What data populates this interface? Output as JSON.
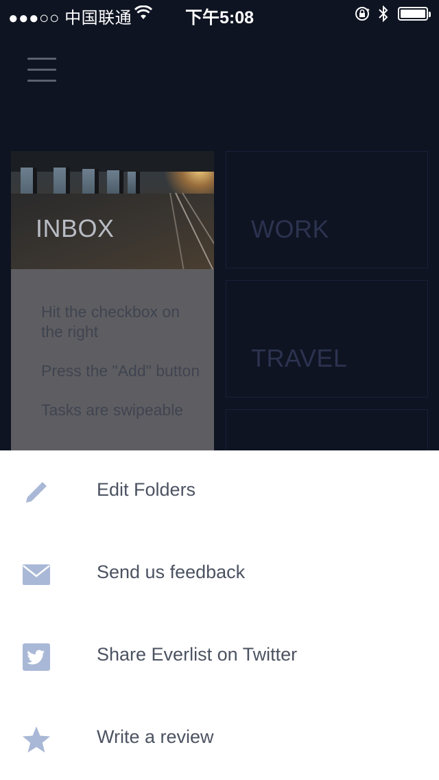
{
  "status_bar": {
    "carrier": "●●●○○ 中国联通",
    "time": "下午5:08",
    "battery_level": 1.0
  },
  "folders": {
    "inbox": {
      "label": "INBOX",
      "tasks": [
        "Hit the checkbox on the right",
        "Press the \"Add\" button",
        "Tasks are swipeable"
      ]
    },
    "work": {
      "label": "WORK"
    },
    "travel": {
      "label": "TRAVEL"
    }
  },
  "menu": {
    "items": [
      {
        "label": "Edit Folders",
        "icon": "pencil-icon"
      },
      {
        "label": "Send us feedback",
        "icon": "envelope-icon"
      },
      {
        "label": "Share Everlist on Twitter",
        "icon": "twitter-icon"
      },
      {
        "label": "Write a review",
        "icon": "star-icon"
      }
    ]
  },
  "colors": {
    "background": "#0f1422",
    "icon_accent": "#a9b8d6",
    "menu_text": "#4b5261"
  }
}
